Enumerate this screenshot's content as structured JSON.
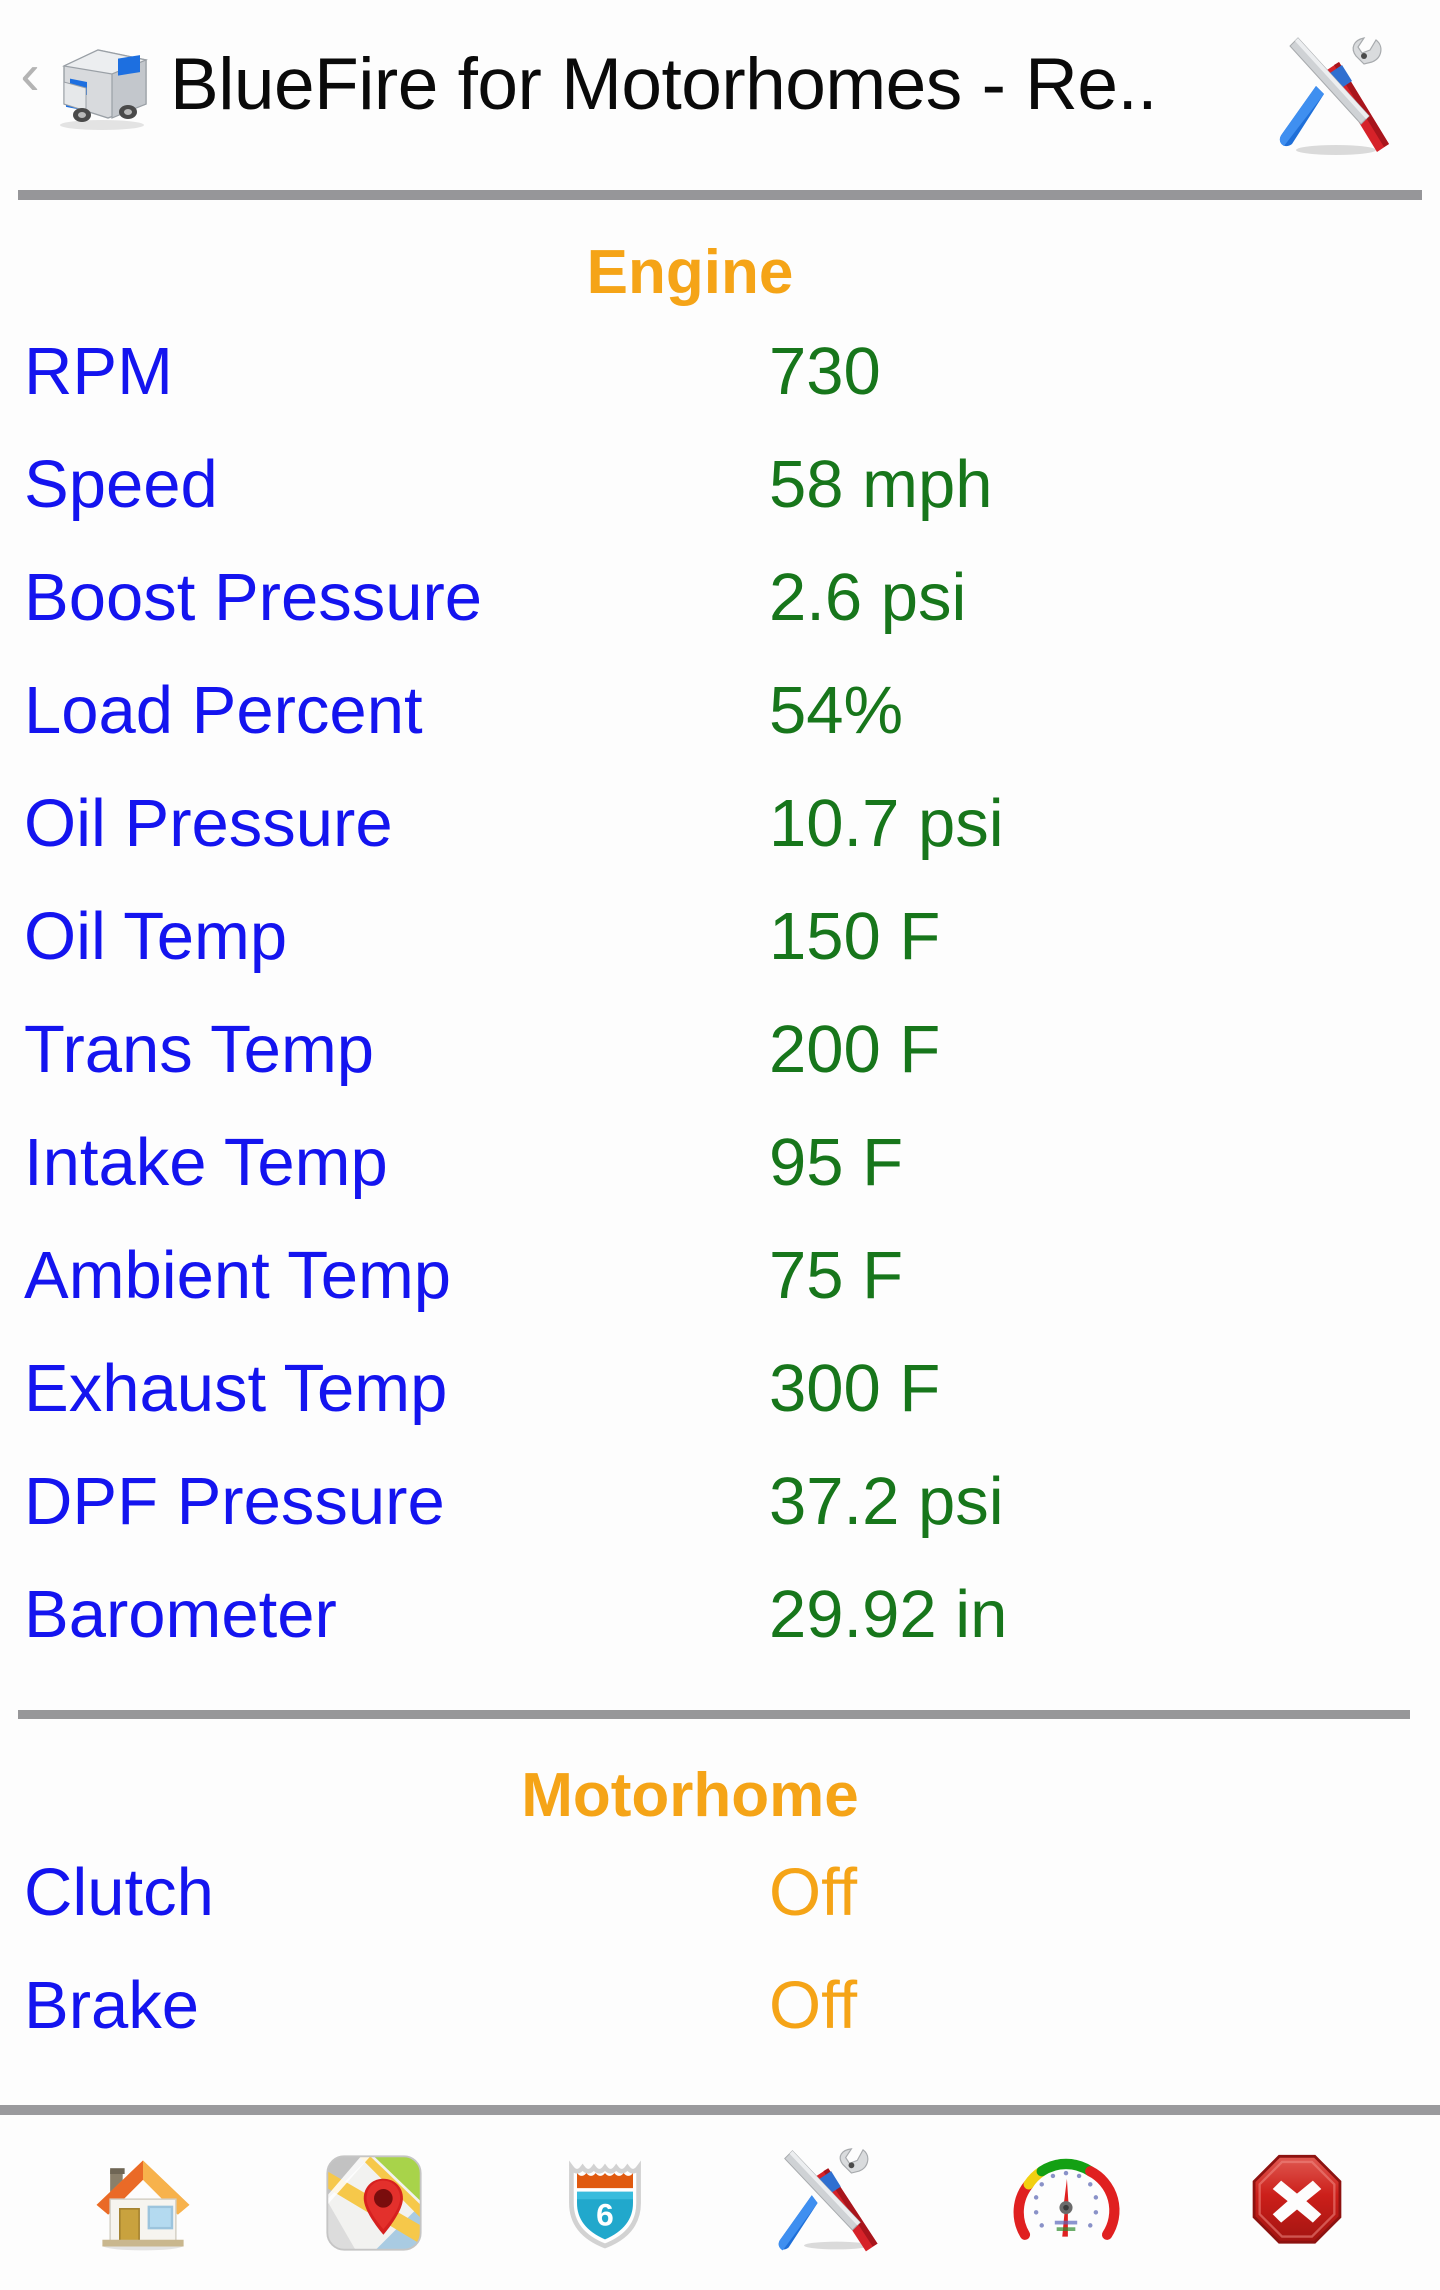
{
  "header": {
    "back_label": "‹",
    "back_icon": "back-chevron-icon",
    "app_icon": "motorhome-rv-icon",
    "title": "BlueFire for Motorhomes - Re..",
    "action_icon": "tools-screwdriver-wrench-icon"
  },
  "sections": [
    {
      "title": "Engine",
      "rows": [
        {
          "label": "RPM",
          "value": "730",
          "kind": "numeric"
        },
        {
          "label": "Speed",
          "value": "58 mph",
          "kind": "numeric"
        },
        {
          "label": "Boost Pressure",
          "value": "2.6 psi",
          "kind": "numeric"
        },
        {
          "label": "Load Percent",
          "value": "54%",
          "kind": "numeric"
        },
        {
          "label": "Oil Pressure",
          "value": "10.7 psi",
          "kind": "numeric"
        },
        {
          "label": "Oil Temp",
          "value": "150 F",
          "kind": "numeric"
        },
        {
          "label": "Trans Temp",
          "value": "200 F",
          "kind": "numeric"
        },
        {
          "label": "Intake Temp",
          "value": "95 F",
          "kind": "numeric"
        },
        {
          "label": "Ambient Temp",
          "value": "75 F",
          "kind": "numeric"
        },
        {
          "label": "Exhaust Temp",
          "value": "300 F",
          "kind": "numeric"
        },
        {
          "label": "DPF Pressure",
          "value": "37.2 psi",
          "kind": "numeric"
        },
        {
          "label": "Barometer",
          "value": "29.92 in",
          "kind": "numeric"
        }
      ]
    },
    {
      "title": "Motorhome",
      "rows": [
        {
          "label": "Clutch",
          "value": "Off",
          "kind": "status"
        },
        {
          "label": "Brake",
          "value": "Off",
          "kind": "status"
        }
      ]
    }
  ],
  "toolbar": {
    "items": [
      {
        "name": "home-icon",
        "label": "Home"
      },
      {
        "name": "map-pin-icon",
        "label": "Map"
      },
      {
        "name": "highway-shield-icon",
        "label": "Highway",
        "shield_number": "6"
      },
      {
        "name": "tools-screwdriver-wrench-icon",
        "label": "Tools"
      },
      {
        "name": "gauge-icon",
        "label": "Gauges"
      },
      {
        "name": "stop-close-icon",
        "label": "Exit"
      }
    ]
  },
  "colors": {
    "label": "#1414ef",
    "value": "#17761b",
    "status": "#f5a417",
    "section_title": "#f5a417",
    "divider": "#969699",
    "background": "#fdfdfd"
  }
}
